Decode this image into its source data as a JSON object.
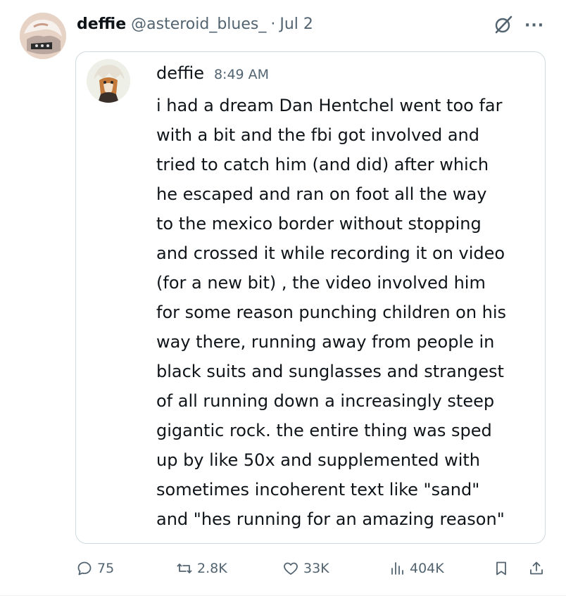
{
  "post": {
    "author_name": "deffie",
    "author_handle": "@asteroid_blues_",
    "separator": "·",
    "date": "Jul 2",
    "more_label": "···"
  },
  "quoted": {
    "author_name": "deffie",
    "time": "8:49 AM",
    "lines": [
      "i had a dream Dan Hentchel went too far",
      "with a bit and the fbi got involved and",
      "tried to catch him (and did) after which",
      "he escaped and ran on foot all the way",
      "to the mexico border without stopping",
      "and crossed it while recording it on video",
      "(for a new bit) , the video involved him",
      "for some reason punching children on his",
      "way there, running away from people in",
      "black suits and sunglasses and strangest",
      "of all running down a increasingly steep",
      "gigantic rock. the entire thing was sped",
      "up by like 50x and supplemented with",
      "sometimes incoherent  text like \"sand\"",
      "and \"hes running for an amazing reason\""
    ]
  },
  "actions": {
    "replies": "75",
    "reposts": "2.8K",
    "likes": "33K",
    "views": "404K"
  },
  "icons": {
    "grok": "grok-icon",
    "more": "more-icon",
    "reply": "reply-icon",
    "repost": "repost-icon",
    "like": "heart-icon",
    "views": "views-icon",
    "bookmark": "bookmark-icon",
    "share": "share-icon"
  },
  "colors": {
    "text": "#0f1419",
    "secondary": "#536471",
    "border": "#cfd9de"
  }
}
